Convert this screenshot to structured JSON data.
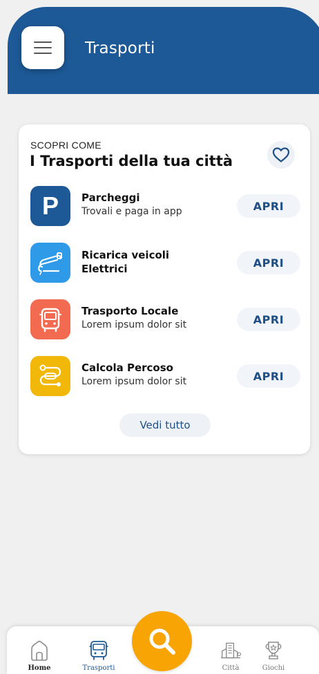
{
  "header": {
    "title": "Trasporti"
  },
  "card": {
    "eyebrow": "SCOPRI COME",
    "title": "I Trasporti della tua città",
    "items": [
      {
        "title": "Parcheggi",
        "subtitle": "Trovali e paga in app",
        "action": "APRI",
        "icon": "parking-icon",
        "icon_letter": "P",
        "color": "#1d5996"
      },
      {
        "title": "Ricarica veicoli Elettrici",
        "subtitle": "",
        "action": "APRI",
        "icon": "ev-charging-icon",
        "color": "#2f9be8"
      },
      {
        "title": "Trasporto Locale",
        "subtitle": "Lorem ipsum dolor sit",
        "action": "APRI",
        "icon": "bus-icon",
        "color": "#f26b50"
      },
      {
        "title": "Calcola Percoso",
        "subtitle": "Lorem ipsum dolor sit",
        "action": "APRI",
        "icon": "route-icon",
        "color": "#f1b80a"
      }
    ],
    "see_all": "Vedi tutto"
  },
  "bottom_nav": {
    "items": [
      {
        "label": "Home",
        "icon": "home-icon"
      },
      {
        "label": "Trasporti",
        "icon": "bus-icon"
      },
      {
        "label": "Città",
        "icon": "city-icon"
      },
      {
        "label": "Giochi",
        "icon": "trophy-icon"
      }
    ],
    "search_icon": "search-icon"
  },
  "colors": {
    "brand": "#1d5996",
    "accent": "#f7a404",
    "action_text": "#1d4f86"
  }
}
